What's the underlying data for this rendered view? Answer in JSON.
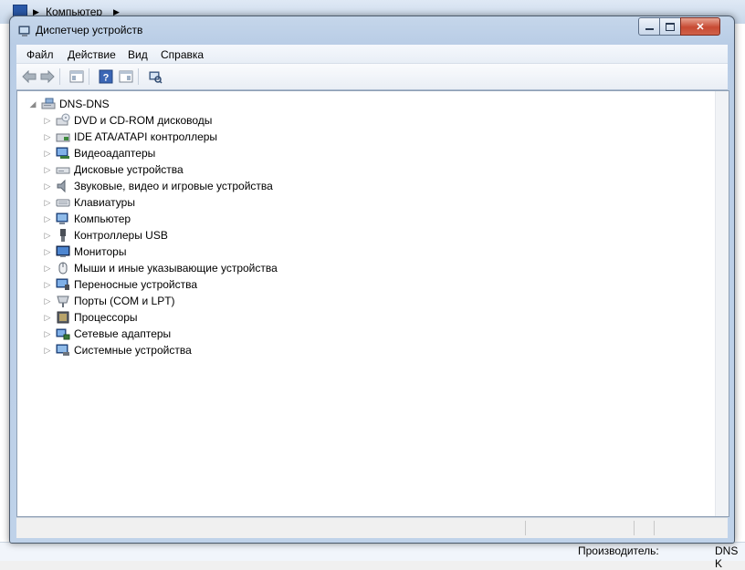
{
  "background": {
    "breadcrumb": "Компьютер",
    "bottom_label": "Производитель:",
    "bottom_value": "DNS K"
  },
  "window": {
    "title": "Диспетчер устройств"
  },
  "menu": [
    "Файл",
    "Действие",
    "Вид",
    "Справка"
  ],
  "toolbar": [
    "back-icon",
    "forward-icon",
    "properties-icon",
    "help-icon",
    "view-icon",
    "scan-hardware-icon"
  ],
  "tree": {
    "root": "DNS-DNS",
    "items": [
      {
        "label": "DVD и CD-ROM дисководы",
        "icon": "dvd-drive-icon"
      },
      {
        "label": "IDE ATA/ATAPI контроллеры",
        "icon": "ide-controller-icon"
      },
      {
        "label": "Видеоадаптеры",
        "icon": "display-adapter-icon"
      },
      {
        "label": "Дисковые устройства",
        "icon": "disk-drive-icon"
      },
      {
        "label": "Звуковые, видео и игровые устройства",
        "icon": "speaker-icon"
      },
      {
        "label": "Клавиатуры",
        "icon": "keyboard-icon"
      },
      {
        "label": "Компьютер",
        "icon": "computer-icon"
      },
      {
        "label": "Контроллеры USB",
        "icon": "usb-icon"
      },
      {
        "label": "Мониторы",
        "icon": "monitor-icon"
      },
      {
        "label": "Мыши и иные указывающие устройства",
        "icon": "mouse-icon"
      },
      {
        "label": "Переносные устройства",
        "icon": "portable-device-icon"
      },
      {
        "label": "Порты (COM и LPT)",
        "icon": "port-icon"
      },
      {
        "label": "Процессоры",
        "icon": "processor-icon"
      },
      {
        "label": "Сетевые адаптеры",
        "icon": "network-adapter-icon"
      },
      {
        "label": "Системные устройства",
        "icon": "system-device-icon"
      }
    ]
  },
  "colors": {
    "title_bar": "#b9cde6",
    "close_button": "#c74a33",
    "content_bg": "#ffffff"
  }
}
